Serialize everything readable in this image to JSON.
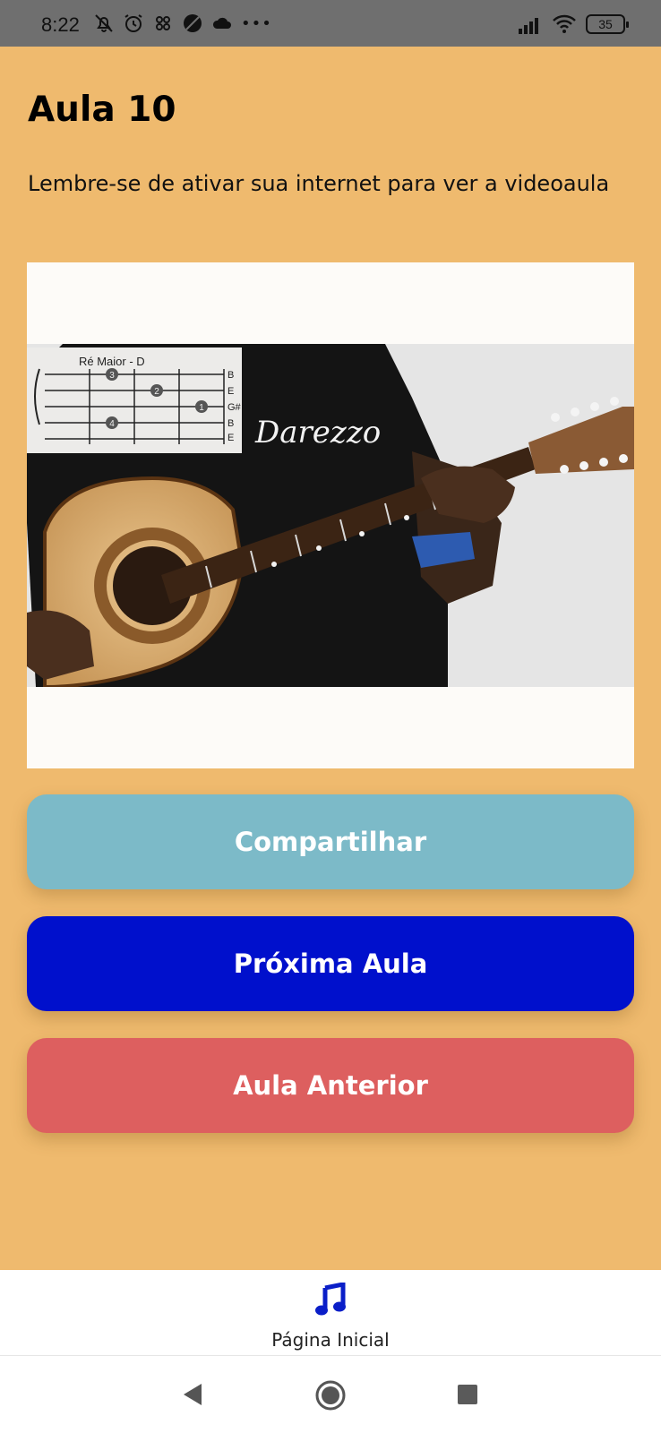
{
  "status_bar": {
    "time": "8:22",
    "battery": "35",
    "more": "•••",
    "icons": [
      "bell-off-icon",
      "alarm-icon",
      "app-icon",
      "pizza-icon",
      "cloud-icon",
      "signal-icon",
      "wifi-icon",
      "battery-icon"
    ]
  },
  "lesson": {
    "title": "Aula 10",
    "hint": "Lembre-se de ativar sua internet para ver a videoaula"
  },
  "video": {
    "chord_name": "Ré Maior - D",
    "string_labels": [
      "B",
      "E",
      "G#",
      "B",
      "E"
    ],
    "finger_numbers": [
      "3",
      "2",
      "1",
      "4"
    ],
    "shirt_text": "Darezzo"
  },
  "buttons": {
    "share": "Compartilhar",
    "next": "Próxima Aula",
    "previous": "Aula Anterior"
  },
  "colors": {
    "background": "#efba6e",
    "share": "#7cbac8",
    "next": "#0010cc",
    "previous": "#dd5f5f",
    "tab_icon": "#0a1ec8"
  },
  "tab_bar": {
    "home_label": "Página Inicial",
    "home_icon": "music-note-icon"
  },
  "nav_bar": {
    "icons": [
      "back-icon",
      "home-circle-icon",
      "recent-apps-icon"
    ]
  }
}
